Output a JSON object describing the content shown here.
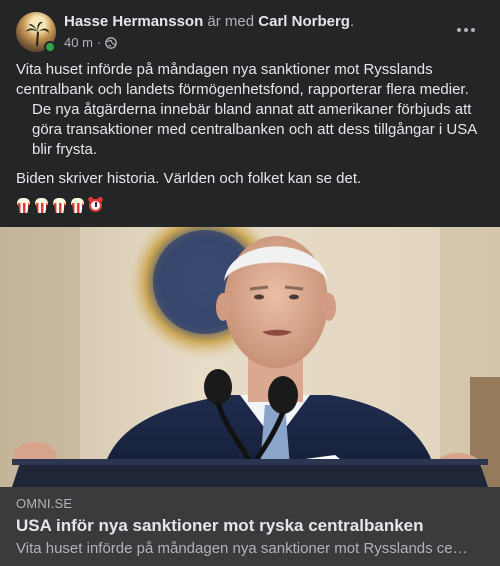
{
  "post": {
    "author": "Hasse Hermansson",
    "with_text": "är med",
    "tagged": "Carl Norberg",
    "period": ".",
    "time": "40 m",
    "separator": "·",
    "privacy_icon": "globe-icon",
    "more_icon": "more-horizontal-icon",
    "paragraphs": [
      "Vita huset införde på måndagen nya sanktioner mot Rysslands centralbank och landets förmögenhetsfond, rapporterar flera medier.",
      "De nya åtgärderna innebär bland annat att amerikaner förbjuds att göra transaktioner med centralbanken och att dess tillgångar i USA blir frysta.",
      "Biden skriver historia. Världen och folket kan se det."
    ],
    "emojis": [
      "popcorn-icon",
      "popcorn-icon",
      "popcorn-icon",
      "popcorn-icon",
      "alarm-clock-icon"
    ]
  },
  "link_preview": {
    "source": "OMNI.SE",
    "title": "USA inför nya sanktioner mot ryska centralbanken",
    "description": "Vita huset införde på måndagen nya sanktioner mot Rysslands ce…"
  },
  "colors": {
    "background": "#242526",
    "card": "#3a3b3c",
    "text_primary": "#e4e6eb",
    "text_secondary": "#b0b3b8",
    "online": "#31a24c"
  }
}
